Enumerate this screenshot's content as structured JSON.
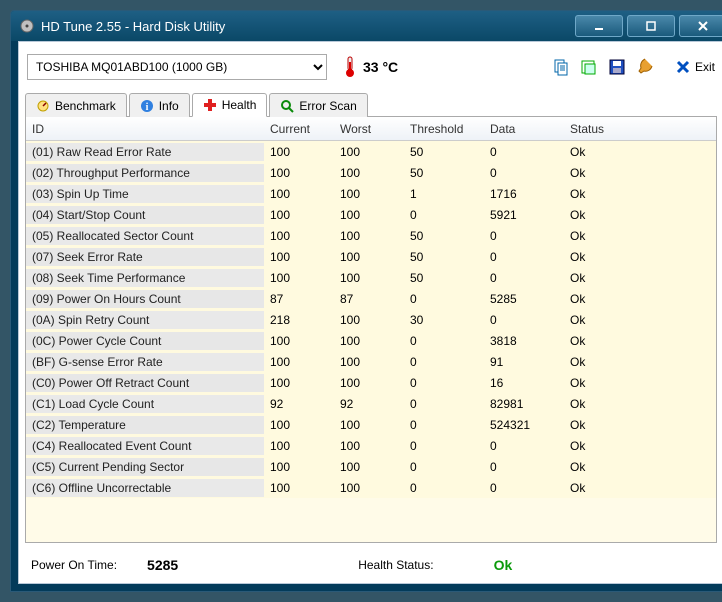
{
  "window": {
    "title": "HD Tune 2.55 - Hard Disk Utility"
  },
  "drive": {
    "selected": "TOSHIBA MQ01ABD100 (1000 GB)"
  },
  "temperature": {
    "value": "33 °C"
  },
  "exit": {
    "label": "Exit"
  },
  "tabs": {
    "benchmark": "Benchmark",
    "info": "Info",
    "health": "Health",
    "error_scan": "Error Scan"
  },
  "columns": {
    "id": "ID",
    "current": "Current",
    "worst": "Worst",
    "threshold": "Threshold",
    "data": "Data",
    "status": "Status"
  },
  "rows": [
    {
      "id": "(01) Raw Read Error Rate",
      "cur": "100",
      "wor": "100",
      "thr": "50",
      "dat": "0",
      "sta": "Ok"
    },
    {
      "id": "(02) Throughput Performance",
      "cur": "100",
      "wor": "100",
      "thr": "50",
      "dat": "0",
      "sta": "Ok"
    },
    {
      "id": "(03) Spin Up Time",
      "cur": "100",
      "wor": "100",
      "thr": "1",
      "dat": "1716",
      "sta": "Ok"
    },
    {
      "id": "(04) Start/Stop Count",
      "cur": "100",
      "wor": "100",
      "thr": "0",
      "dat": "5921",
      "sta": "Ok"
    },
    {
      "id": "(05) Reallocated Sector Count",
      "cur": "100",
      "wor": "100",
      "thr": "50",
      "dat": "0",
      "sta": "Ok"
    },
    {
      "id": "(07) Seek Error Rate",
      "cur": "100",
      "wor": "100",
      "thr": "50",
      "dat": "0",
      "sta": "Ok"
    },
    {
      "id": "(08) Seek Time Performance",
      "cur": "100",
      "wor": "100",
      "thr": "50",
      "dat": "0",
      "sta": "Ok"
    },
    {
      "id": "(09) Power On Hours Count",
      "cur": "87",
      "wor": "87",
      "thr": "0",
      "dat": "5285",
      "sta": "Ok"
    },
    {
      "id": "(0A) Spin Retry Count",
      "cur": "218",
      "wor": "100",
      "thr": "30",
      "dat": "0",
      "sta": "Ok"
    },
    {
      "id": "(0C) Power Cycle Count",
      "cur": "100",
      "wor": "100",
      "thr": "0",
      "dat": "3818",
      "sta": "Ok"
    },
    {
      "id": "(BF) G-sense Error Rate",
      "cur": "100",
      "wor": "100",
      "thr": "0",
      "dat": "91",
      "sta": "Ok"
    },
    {
      "id": "(C0) Power Off Retract Count",
      "cur": "100",
      "wor": "100",
      "thr": "0",
      "dat": "16",
      "sta": "Ok"
    },
    {
      "id": "(C1) Load Cycle Count",
      "cur": "92",
      "wor": "92",
      "thr": "0",
      "dat": "82981",
      "sta": "Ok"
    },
    {
      "id": "(C2) Temperature",
      "cur": "100",
      "wor": "100",
      "thr": "0",
      "dat": "524321",
      "sta": "Ok"
    },
    {
      "id": "(C4) Reallocated Event Count",
      "cur": "100",
      "wor": "100",
      "thr": "0",
      "dat": "0",
      "sta": "Ok"
    },
    {
      "id": "(C5) Current Pending Sector",
      "cur": "100",
      "wor": "100",
      "thr": "0",
      "dat": "0",
      "sta": "Ok"
    },
    {
      "id": "(C6) Offline Uncorrectable",
      "cur": "100",
      "wor": "100",
      "thr": "0",
      "dat": "0",
      "sta": "Ok"
    }
  ],
  "footer": {
    "power_on_label": "Power On Time:",
    "power_on_value": "5285",
    "health_label": "Health Status:",
    "health_value": "Ok"
  }
}
